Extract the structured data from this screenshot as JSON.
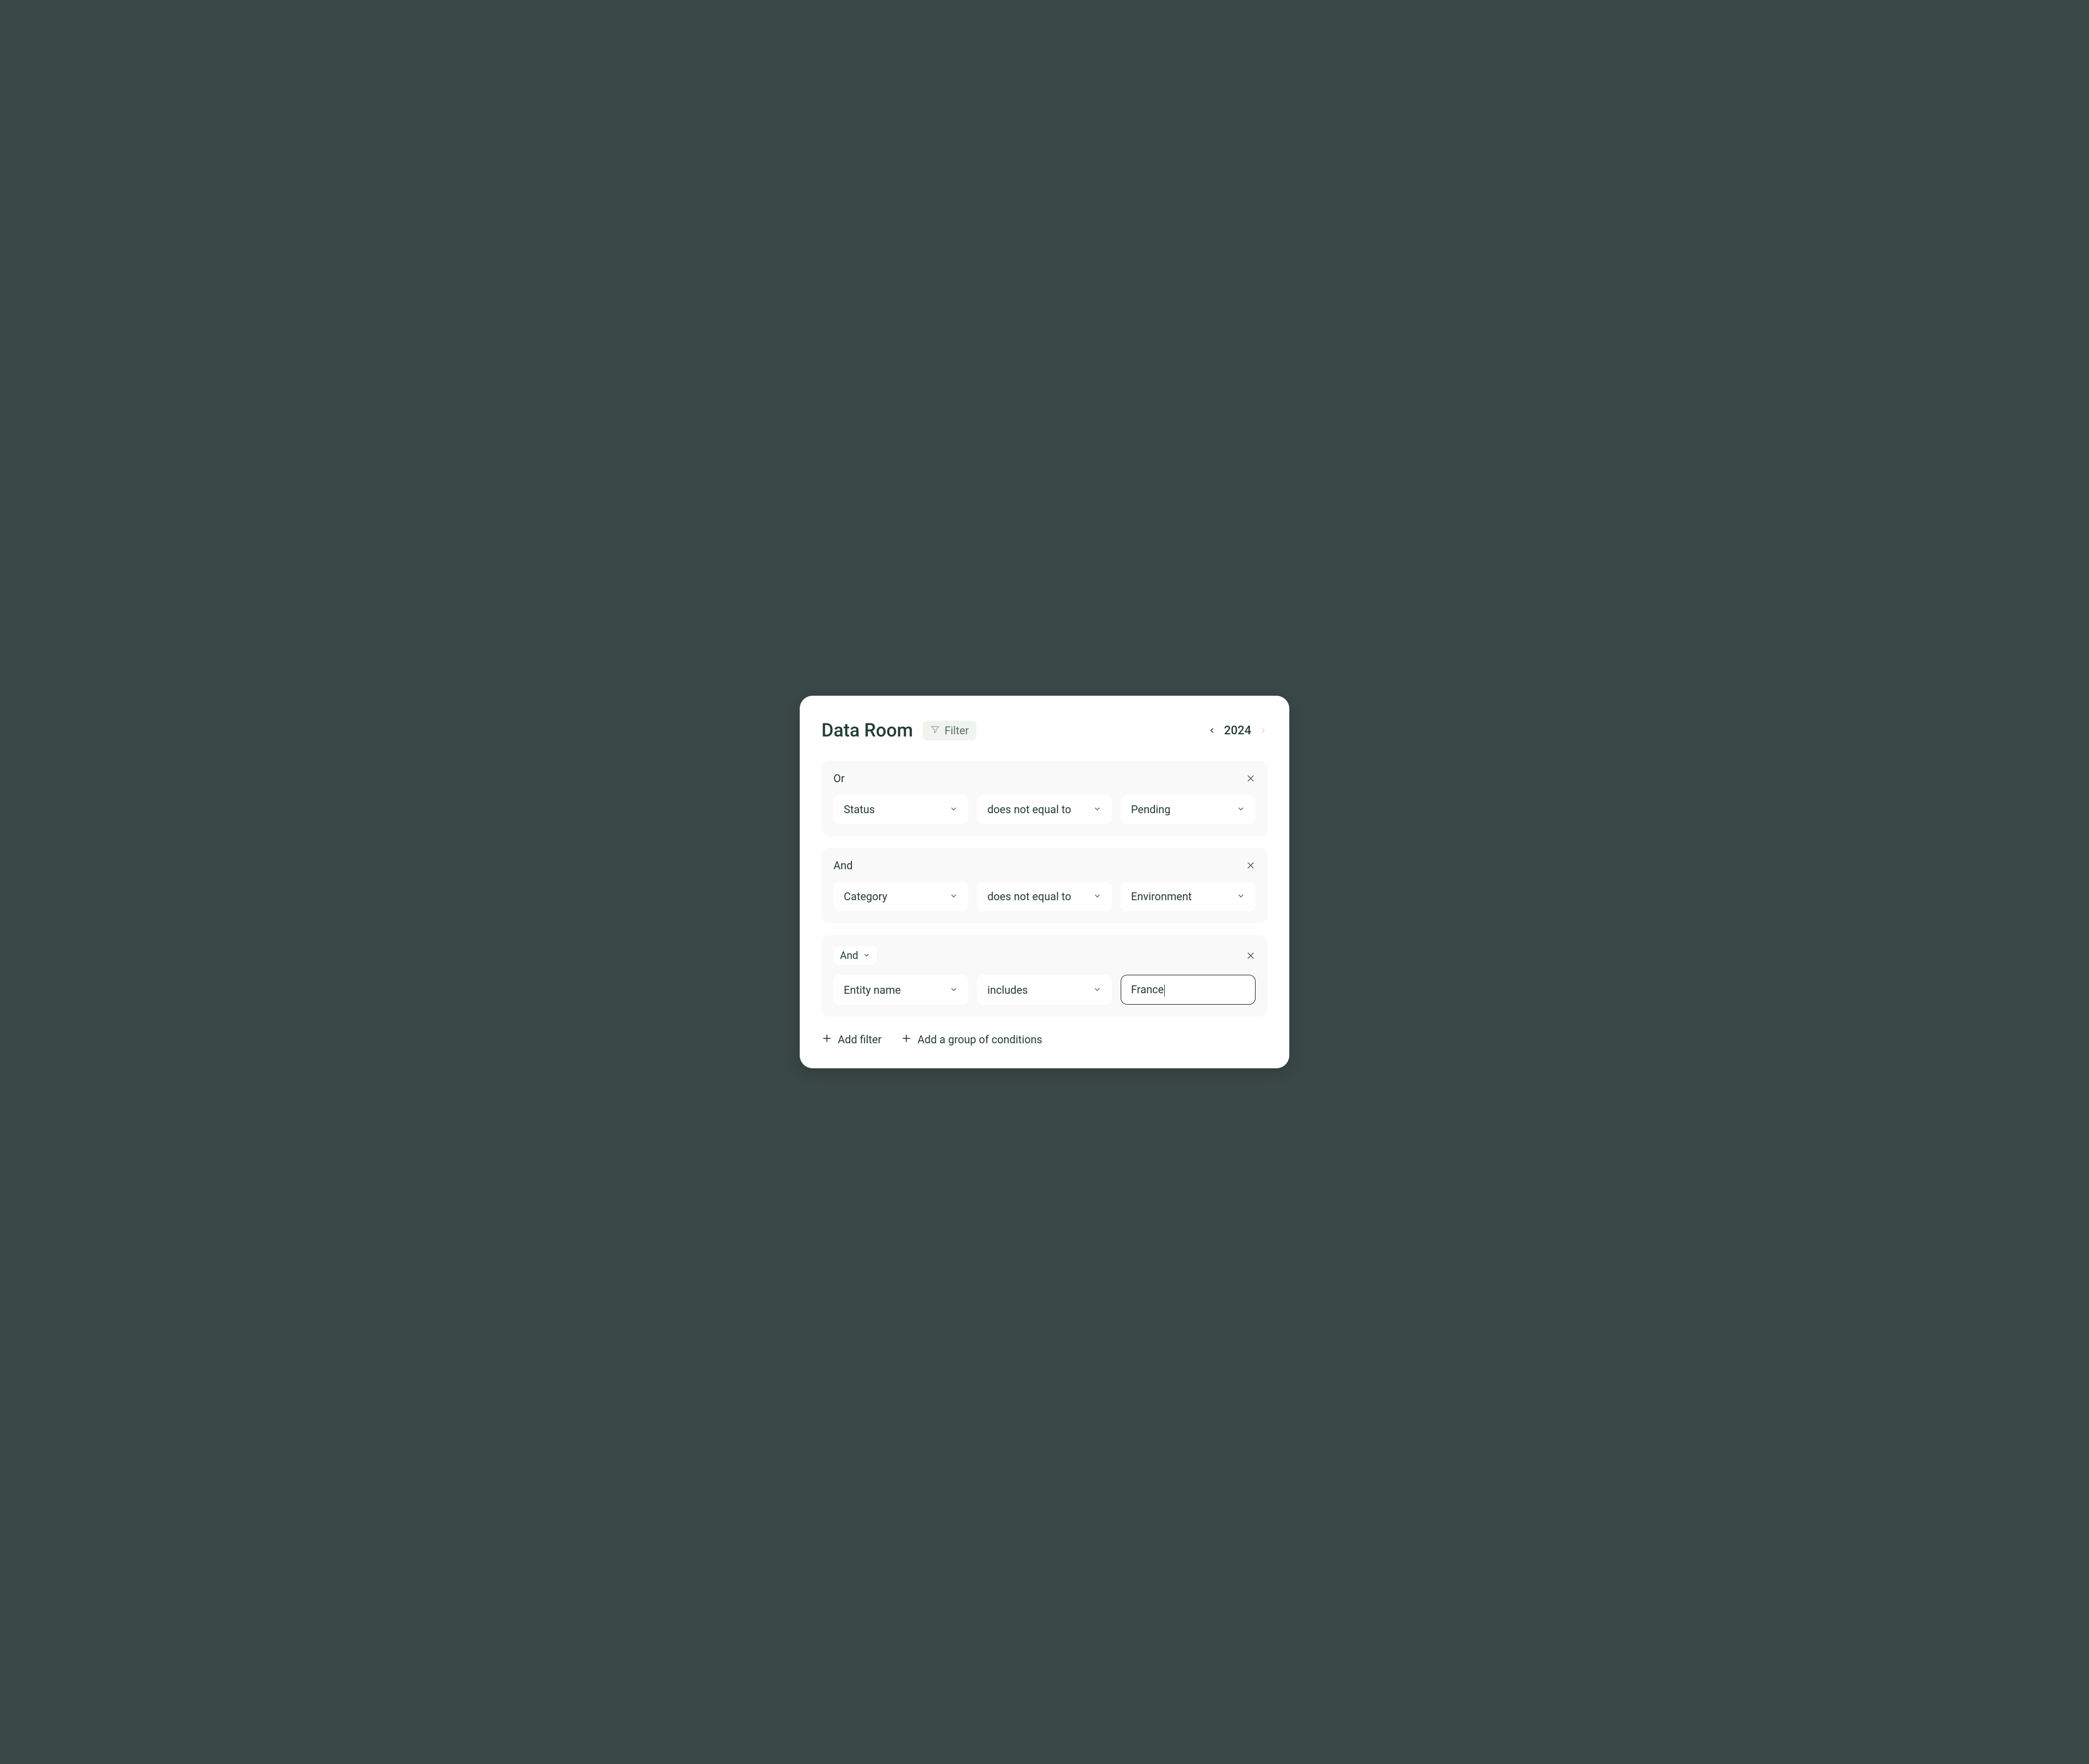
{
  "header": {
    "title": "Data Room",
    "filter_label": "Filter",
    "year": "2024"
  },
  "groups": [
    {
      "logic": "Or",
      "logic_editable": false,
      "field": "Status",
      "operator": "does not equal to",
      "value": "Pending",
      "value_is_input": false
    },
    {
      "logic": "And",
      "logic_editable": false,
      "field": "Category",
      "operator": "does not equal to",
      "value": "Environment",
      "value_is_input": false
    },
    {
      "logic": "And",
      "logic_editable": true,
      "field": "Entity name",
      "operator": "includes",
      "value": "France",
      "value_is_input": true
    }
  ],
  "footer": {
    "add_filter": "Add filter",
    "add_group": "Add a group of conditions"
  }
}
